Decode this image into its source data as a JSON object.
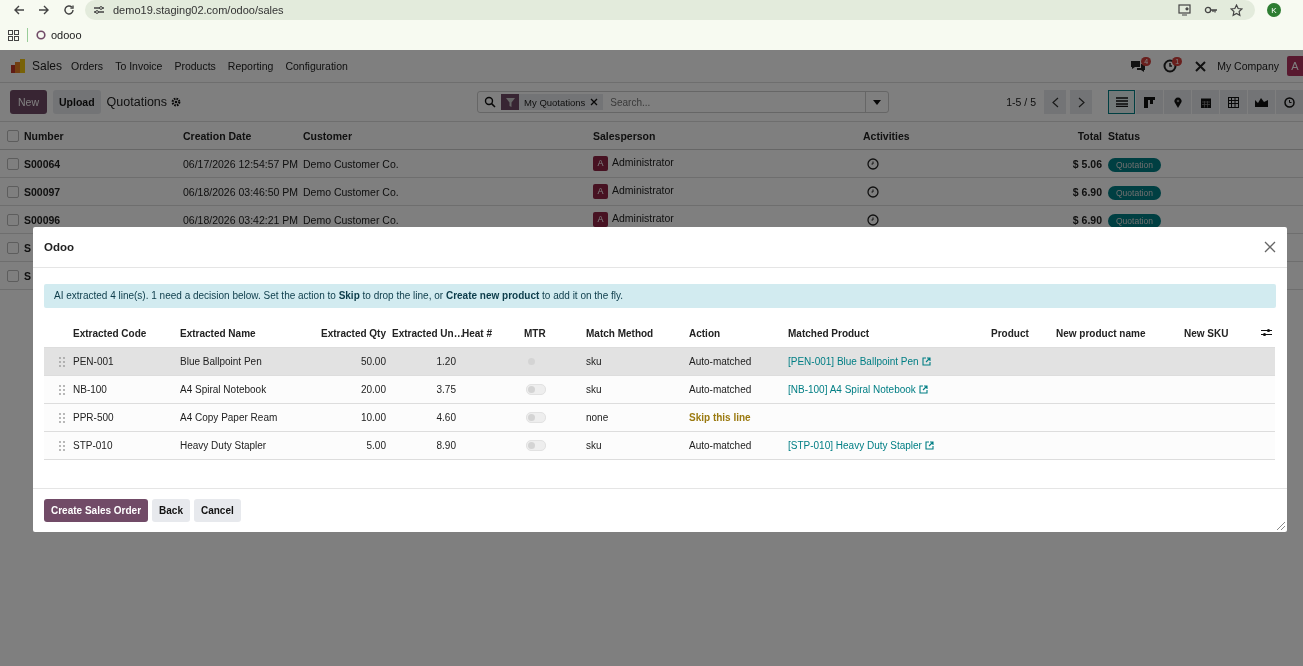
{
  "browser": {
    "url": "demo19.staging02.com/odoo/sales",
    "bookmark": "odooo",
    "profile_initial": "K"
  },
  "navbar": {
    "app": "Sales",
    "menus": [
      "Orders",
      "To Invoice",
      "Products",
      "Reporting",
      "Configuration"
    ],
    "messages_count": "4",
    "activities_count": "1",
    "company": "My Company",
    "user_initial": "A"
  },
  "control_panel": {
    "new_button": "New",
    "upload_button": "Upload",
    "title": "Quotations",
    "facet": "My Quotations",
    "search_placeholder": "Search...",
    "pager": "1-5 / 5",
    "views": [
      {
        "kind": "list",
        "selected": true
      },
      {
        "kind": "kanban",
        "selected": false
      },
      {
        "kind": "map",
        "selected": false
      },
      {
        "kind": "calendar",
        "selected": false
      },
      {
        "kind": "pivot",
        "selected": false
      },
      {
        "kind": "graph",
        "selected": false
      },
      {
        "kind": "activity",
        "selected": false
      }
    ]
  },
  "list": {
    "all_checked": false,
    "columns": [
      "Number",
      "Creation Date",
      "Customer",
      "Salesperson",
      "Activities",
      "Total",
      "Status"
    ],
    "rows": [
      {
        "checked": false,
        "number": "S00064",
        "date": "06/17/2026 12:54:57 PM",
        "customer": "Demo Customer Co.",
        "salesperson_initial": "A",
        "salesperson": "Administrator",
        "total": "$ 5.06",
        "status": "Quotation"
      },
      {
        "checked": false,
        "number": "S00097",
        "date": "06/18/2026 03:46:50 PM",
        "customer": "Demo Customer Co.",
        "salesperson_initial": "A",
        "salesperson": "Administrator",
        "total": "$ 6.90",
        "status": "Quotation"
      },
      {
        "checked": false,
        "number": "S00096",
        "date": "06/18/2026 03:42:21 PM",
        "customer": "Demo Customer Co.",
        "salesperson_initial": "A",
        "salesperson": "Administrator",
        "total": "$ 6.90",
        "status": "Quotation"
      },
      {
        "checked": false,
        "number": "S"
      },
      {
        "checked": false,
        "number": "S"
      }
    ]
  },
  "dialog": {
    "title": "Odoo",
    "alert": "AI extracted 4 line(s). 1 need a decision below. Set the action to **Skip** to drop the line, or **Create new product** to add it on the fly.",
    "columns": [
      "Extracted Code",
      "Extracted Name",
      "Extracted Qty",
      "Extracted Un…",
      "Heat #",
      "MTR",
      "Match Method",
      "Action",
      "Matched Product",
      "Product",
      "New product name",
      "New SKU"
    ],
    "lines": [
      {
        "code": "PEN-001",
        "name": "Blue Ballpoint Pen",
        "qty": "50.00",
        "unit": "1.20",
        "mtr": false,
        "method": "sku",
        "action": "Auto-matched",
        "kind": "matched",
        "matched": "[PEN-001] Blue Ballpoint Pen",
        "selected": true
      },
      {
        "code": "NB-100",
        "name": "A4 Spiral Notebook",
        "qty": "20.00",
        "unit": "3.75",
        "mtr": false,
        "method": "sku",
        "action": "Auto-matched",
        "kind": "matched",
        "matched": "[NB-100] A4 Spiral Notebook",
        "selected": false
      },
      {
        "code": "PPR-500",
        "name": "A4 Copy Paper Ream",
        "qty": "10.00",
        "unit": "4.60",
        "mtr": false,
        "method": "none",
        "action": "Skip this line",
        "kind": "skip",
        "selected": false
      },
      {
        "code": "STP-010",
        "name": "Heavy Duty Stapler",
        "qty": "5.00",
        "unit": "8.90",
        "mtr": false,
        "method": "sku",
        "action": "Auto-matched",
        "kind": "matched",
        "matched": "[STP-010] Heavy Duty Stapler",
        "selected": false
      }
    ],
    "buttons": [
      {
        "label": "Create Sales Order",
        "kind": "primary"
      },
      {
        "label": "Back",
        "kind": "secondary"
      },
      {
        "label": "Cancel",
        "kind": "secondary"
      }
    ]
  }
}
